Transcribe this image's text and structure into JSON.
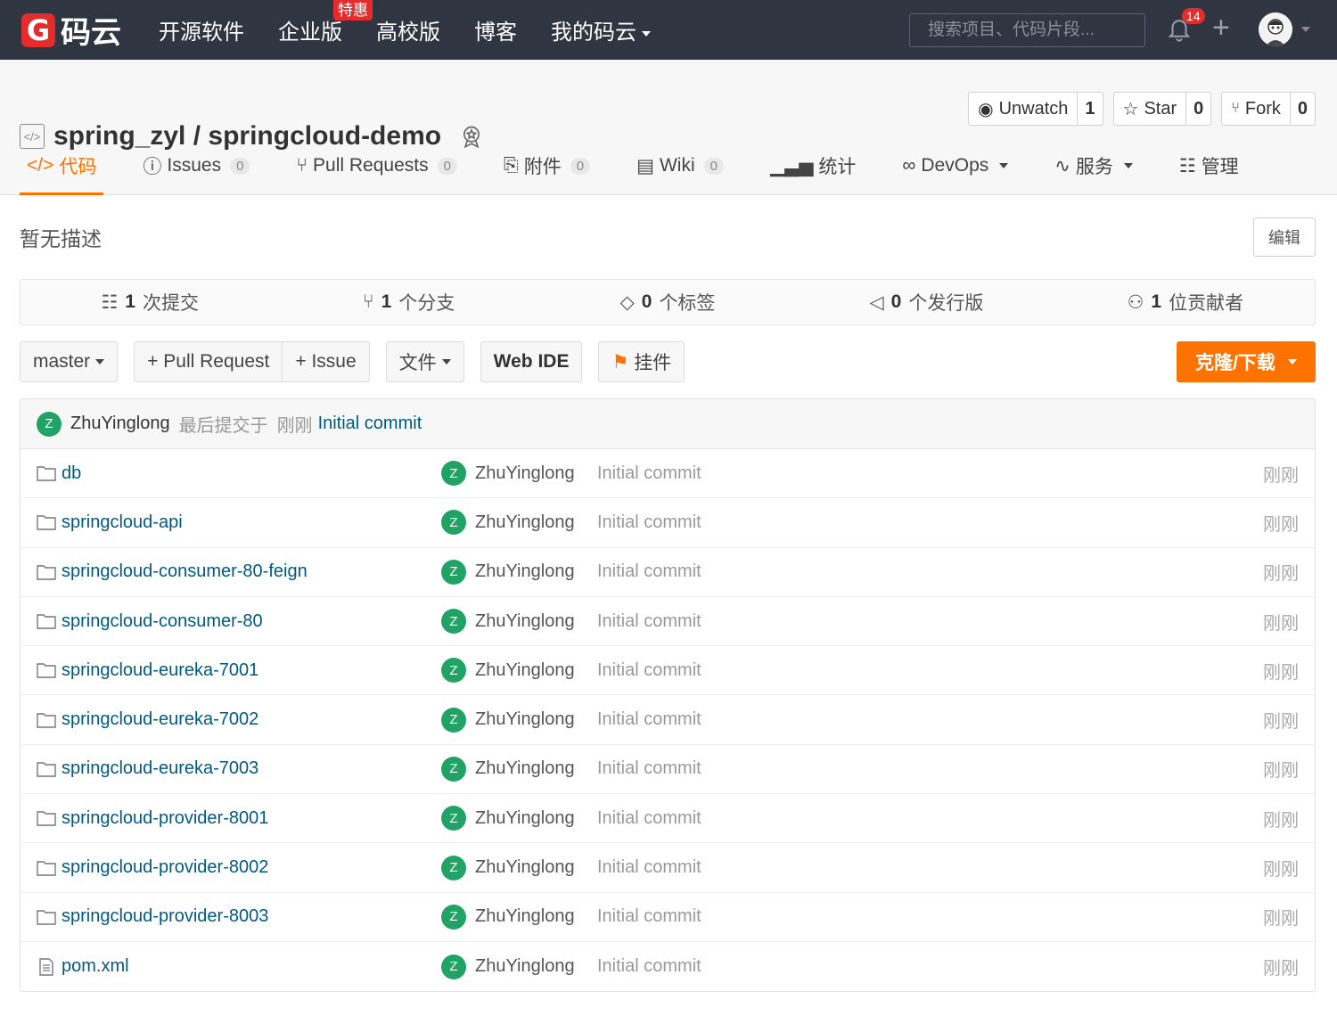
{
  "nav": {
    "logo_mark": "G",
    "logo_text": "码云",
    "items": [
      {
        "label": "开源软件"
      },
      {
        "label": "企业版",
        "badge": "特惠"
      },
      {
        "label": "高校版"
      },
      {
        "label": "博客"
      },
      {
        "label": "我的码云"
      }
    ],
    "search_placeholder": "搜索项目、代码片段...",
    "notification_count": "14",
    "plus_label": "+"
  },
  "repo": {
    "owner": "spring_zyl",
    "separator": "/",
    "name": "springcloud-demo",
    "actions": {
      "watch_label": "Unwatch",
      "watch_count": "1",
      "star_label": "Star",
      "star_count": "0",
      "fork_label": "Fork",
      "fork_count": "0"
    },
    "tabs": [
      {
        "label": "代码",
        "icon": "code-icon"
      },
      {
        "label": "Issues",
        "count": "0",
        "icon": "issue-icon"
      },
      {
        "label": "Pull Requests",
        "count": "0",
        "icon": "pull-request-icon"
      },
      {
        "label": "附件",
        "count": "0",
        "icon": "attachment-icon"
      },
      {
        "label": "Wiki",
        "count": "0",
        "icon": "book-icon"
      },
      {
        "label": "统计",
        "icon": "chart-icon"
      },
      {
        "label": "DevOps",
        "icon": "infinity-icon"
      },
      {
        "label": "服务",
        "icon": "pulse-icon"
      },
      {
        "label": "管理",
        "icon": "settings-doc-icon"
      }
    ]
  },
  "description": "暂无描述",
  "edit_label": "编辑",
  "stats": {
    "commits_num": "1",
    "commits_label": "次提交",
    "branches_num": "1",
    "branches_label": "个分支",
    "tags_num": "0",
    "tags_label": "个标签",
    "releases_num": "0",
    "releases_label": "个发行版",
    "contributors_num": "1",
    "contributors_label": "位贡献者"
  },
  "toolbar": {
    "branch": "master",
    "pull_request": "+ Pull Request",
    "issue": "+ Issue",
    "files": "文件",
    "web_ide": "Web IDE",
    "widget": "挂件",
    "clone": "克隆/下载"
  },
  "last_commit": {
    "avatar_letter": "Z",
    "author": "ZhuYinglong",
    "text": "最后提交于",
    "time": "刚刚",
    "message": "Initial commit"
  },
  "files": [
    {
      "name": "db",
      "type": "folder",
      "author": "ZhuYinglong",
      "avatar": "Z",
      "message": "Initial commit",
      "time": "刚刚"
    },
    {
      "name": "springcloud-api",
      "type": "folder",
      "author": "ZhuYinglong",
      "avatar": "Z",
      "message": "Initial commit",
      "time": "刚刚"
    },
    {
      "name": "springcloud-consumer-80-feign",
      "type": "folder",
      "author": "ZhuYinglong",
      "avatar": "Z",
      "message": "Initial commit",
      "time": "刚刚"
    },
    {
      "name": "springcloud-consumer-80",
      "type": "folder",
      "author": "ZhuYinglong",
      "avatar": "Z",
      "message": "Initial commit",
      "time": "刚刚"
    },
    {
      "name": "springcloud-eureka-7001",
      "type": "folder",
      "author": "ZhuYinglong",
      "avatar": "Z",
      "message": "Initial commit",
      "time": "刚刚"
    },
    {
      "name": "springcloud-eureka-7002",
      "type": "folder",
      "author": "ZhuYinglong",
      "avatar": "Z",
      "message": "Initial commit",
      "time": "刚刚"
    },
    {
      "name": "springcloud-eureka-7003",
      "type": "folder",
      "author": "ZhuYinglong",
      "avatar": "Z",
      "message": "Initial commit",
      "time": "刚刚"
    },
    {
      "name": "springcloud-provider-8001",
      "type": "folder",
      "author": "ZhuYinglong",
      "avatar": "Z",
      "message": "Initial commit",
      "time": "刚刚"
    },
    {
      "name": "springcloud-provider-8002",
      "type": "folder",
      "author": "ZhuYinglong",
      "avatar": "Z",
      "message": "Initial commit",
      "time": "刚刚"
    },
    {
      "name": "springcloud-provider-8003",
      "type": "folder",
      "author": "ZhuYinglong",
      "avatar": "Z",
      "message": "Initial commit",
      "time": "刚刚"
    },
    {
      "name": "pom.xml",
      "type": "file",
      "author": "ZhuYinglong",
      "avatar": "Z",
      "message": "Initial commit",
      "time": "刚刚"
    }
  ],
  "colors": {
    "nav_bg": "#2f3541",
    "accent": "#fe7300",
    "brand_red": "#e52c2c",
    "link": "#005980",
    "avatar_green": "#21a366"
  }
}
